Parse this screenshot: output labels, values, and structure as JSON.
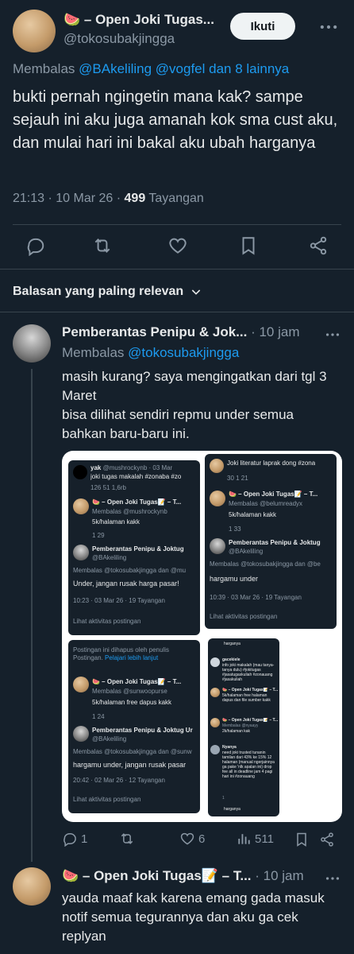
{
  "tweet": {
    "display_name": "🍉 – Open Joki Tugas...",
    "handle": "@tokosubakjingga",
    "follow_label": "Ikuti",
    "reply_prefix": "Membalas",
    "reply_to": "@BAkeliling @vogfel dan 8 lainnya",
    "text": "bukti pernah ngingetin mana kak? sampe sejauh ini aku juga amanah kok sma cust aku, dan mulai hari ini bakal aku ubah harganya",
    "timestamp": "21:13 · 10 Mar 26 ·",
    "views_count": "499",
    "views_label": "Tayangan"
  },
  "replies_header": {
    "label": "Balasan yang paling relevan"
  },
  "reply1": {
    "display_name": "Pemberantas Penipu & Jok...",
    "time": "· 10 jam",
    "reply_prefix": "Membalas",
    "reply_to": "@tokosubakjingga",
    "text": "masih kurang? saya mengingatkan dari tgl 3 Maret\nbisa dilihat sendiri repmu under semua bahkan baru-baru ini.",
    "stats": {
      "replies": "1",
      "reposts": "",
      "likes": "6",
      "views": "511"
    }
  },
  "reply2": {
    "display_name": "🍉 – Open Joki Tugas📝 – T...",
    "time": "· 10 jam",
    "text": "yauda maaf kak karena emang gada masuk notif semua tegurannya dan aku ga cek replyan"
  },
  "collage": {
    "tl": {
      "yak_name": "yak",
      "yak_handle": "@mushrockynb · 03 Mar",
      "yak_text": "joki tugas makalah #zonaba #zo",
      "yak_stats": "126   51   1,6rb",
      "toko_name": "🍉 – Open Joki Tugas📝 – T...",
      "toko_reply": "Membalas @mushrockynb",
      "toko_text": "5k/halaman kakk",
      "toko_stats": "1              29",
      "pp_name": "Pemberantas Penipu & Joktug",
      "pp_handle": "@BAkeliling",
      "pp_reply": "Membalas @tokosubakjingga dan @mu",
      "pp_text": "Under, jangan rusak harga pasar!",
      "pp_time": "10:23 · 03 Mar 26 · 19 Tayangan",
      "activity": "Lihat aktivitas postingan"
    },
    "tr": {
      "top_text": "Joki literatur laprak dong #zona",
      "top_stats": "30   1   21",
      "toko_name": "🍉 – Open Joki Tugas📝 – T...",
      "toko_reply": "Membalas @belumreadyx",
      "toko_text": "5k/halaman kakk",
      "toko_stats": "1            33",
      "pp_name": "Pemberantas Penipu & Joktug",
      "pp_handle": "@BAkeliling",
      "pp_reply": "Membalas @tokosubakjingga dan @be",
      "pp_text": "hargamu under",
      "pp_time": "10:39 · 03 Mar 26 · 19 Tayangan",
      "activity": "Lihat aktivitas postingan"
    },
    "bl": {
      "deleted": "Postingan ini dihapus oleh penulis Postingan.",
      "learn_more": "Pelajari lebih lanjut",
      "toko_name": "🍉 – Open Joki Tugas📝 – T...",
      "toko_reply": "Membalas @sunwoopurse",
      "toko_text": "5k/halaman free dapus kakk",
      "toko_stats": "1           24",
      "pp_name": "Pemberantas Penipu & Joktug Ur",
      "pp_handle": "@BAkeliling",
      "pp_reply": "Membalas @tokosubakjingga dan @sunw",
      "pp_text": "hargamu under, jangan rusak pasar",
      "pp_time": "20:42 · 02 Mar 26 · 12 Tayangan",
      "activity": "Lihat aktivitas postingan"
    },
    "br": {
      "top": "harganya",
      "g_name": "gacekiele",
      "g_text": "info joki makalah (mau tanya-tanya dulu) #jokitugas #jasatugaskuliah #zonauang #jasakuliah",
      "t1_name": "🍉 – Open Joki Tugas📝 – T...",
      "t1_text": "5k/halaman free halaman dapus dan file sumber kakk",
      "t2_name": "🍉 – Open Joki Tugas📝 – T...",
      "t2_reply": "Membalas @nyaayy",
      "t2_text": "2k/halaman kak",
      "n_name": "Nyanya",
      "n_text": "need joki trusted tunanin tamilan dari 43% ke 15% 12 halaman (manual ngerjainnya ga pake 'nlk apalan ini) drop fee all in deadline jam 4 pagi hari ini #zonauang",
      "n_stats": "1",
      "bottom": "harganya"
    }
  },
  "colors": {
    "background": "#15202b",
    "text": "#e7e9ea",
    "muted": "#8b98a5",
    "link": "#1d9bf0",
    "divider": "#38444d"
  }
}
